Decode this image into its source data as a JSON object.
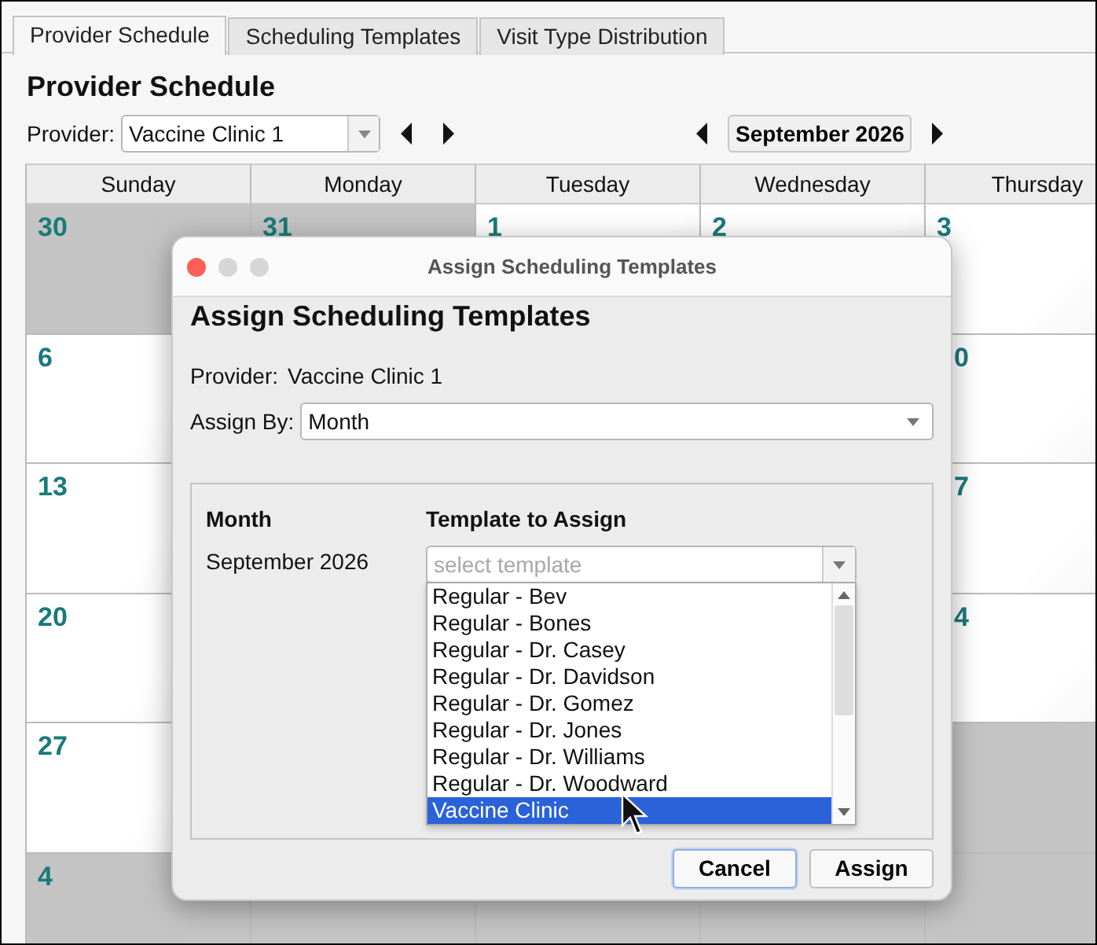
{
  "tabs": [
    {
      "label": "Provider Schedule",
      "selected": true
    },
    {
      "label": "Scheduling Templates",
      "selected": false
    },
    {
      "label": "Visit Type Distribution",
      "selected": false
    }
  ],
  "heading": "Provider Schedule",
  "provider": {
    "label": "Provider:",
    "value": "Vaccine Clinic 1"
  },
  "month_nav": {
    "label": "September 2026"
  },
  "calendar": {
    "columns": [
      "Sunday",
      "Monday",
      "Tuesday",
      "Wednesday",
      "Thursday"
    ],
    "rows": [
      [
        {
          "day": "30",
          "out_of_month": true
        },
        {
          "day": "31",
          "out_of_month": true
        },
        {
          "day": "1",
          "out_of_month": false
        },
        {
          "day": "2",
          "out_of_month": false
        },
        {
          "day": "3",
          "out_of_month": false
        }
      ],
      [
        {
          "day": "6",
          "out_of_month": false
        },
        null,
        null,
        null,
        {
          "day": "0",
          "out_of_month": false,
          "partial": true
        }
      ],
      [
        {
          "day": "13",
          "out_of_month": false
        },
        null,
        null,
        null,
        {
          "day": "7",
          "out_of_month": false,
          "partial": true
        }
      ],
      [
        {
          "day": "20",
          "out_of_month": false
        },
        null,
        null,
        null,
        {
          "day": "4",
          "out_of_month": false,
          "partial": true
        }
      ],
      [
        {
          "day": "27",
          "out_of_month": false
        },
        null,
        null,
        null,
        {
          "out_of_month": true
        }
      ],
      [
        {
          "day": "4",
          "out_of_month": true
        },
        {
          "out_of_month": true
        },
        {
          "out_of_month": true
        },
        {
          "out_of_month": true
        },
        {
          "out_of_month": true
        }
      ]
    ]
  },
  "dialog": {
    "title": "Assign Scheduling Templates",
    "heading": "Assign Scheduling Templates",
    "provider_label": "Provider:",
    "provider_value": "Vaccine Clinic 1",
    "assign_by": {
      "label": "Assign By:",
      "value": "Month"
    },
    "columns": [
      "Month",
      "Template to Assign"
    ],
    "month": "September 2026",
    "template": {
      "placeholder": "select template",
      "options": [
        {
          "label": "Regular - Bev",
          "selected": false
        },
        {
          "label": "Regular - Bones",
          "selected": false
        },
        {
          "label": "Regular - Dr. Casey",
          "selected": false
        },
        {
          "label": "Regular - Dr. Davidson",
          "selected": false
        },
        {
          "label": "Regular - Dr. Gomez",
          "selected": false
        },
        {
          "label": "Regular - Dr. Jones",
          "selected": false
        },
        {
          "label": "Regular - Dr. Williams",
          "selected": false
        },
        {
          "label": "Regular - Dr. Woodward",
          "selected": false
        },
        {
          "label": "Vaccine Clinic",
          "selected": true
        }
      ]
    },
    "buttons": [
      {
        "label": "Cancel",
        "focused": true
      },
      {
        "label": "Assign",
        "focused": false
      }
    ]
  }
}
